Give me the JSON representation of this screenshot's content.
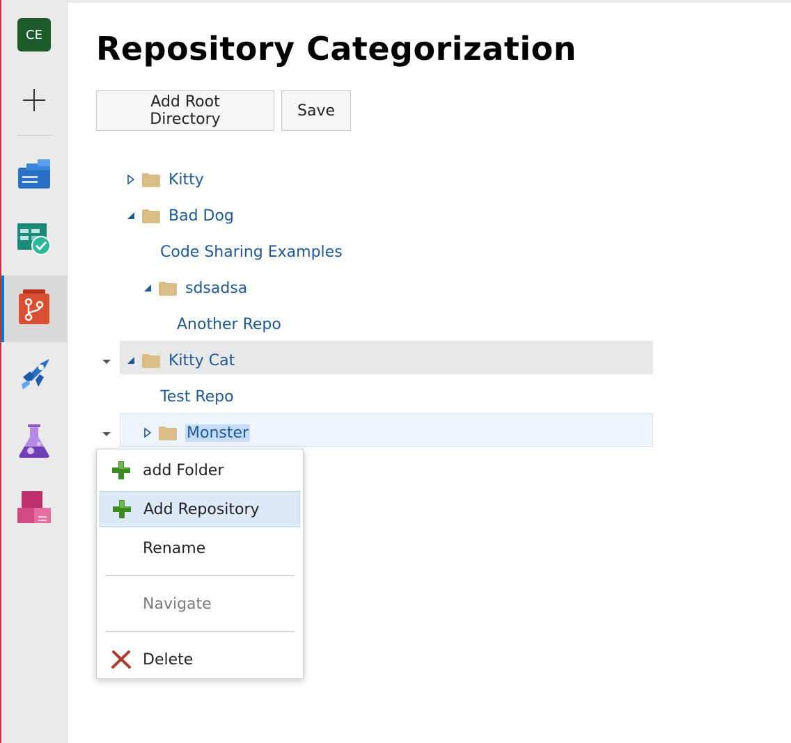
{
  "sidebar": {
    "avatar_initials": "CE",
    "items": [
      {
        "name": "new-icon"
      },
      {
        "name": "boards-icon"
      },
      {
        "name": "test-plans-check-icon"
      },
      {
        "name": "repos-icon",
        "active": true
      },
      {
        "name": "pipelines-icon"
      },
      {
        "name": "test-flask-icon"
      },
      {
        "name": "artifacts-icon"
      }
    ]
  },
  "page": {
    "title": "Repository Categorization",
    "buttons": {
      "add_root": "Add Root Directory",
      "save": "Save"
    }
  },
  "tree": {
    "nodes": [
      {
        "label": "Kitty",
        "type": "folder",
        "expanded": false
      },
      {
        "label": "Bad Dog",
        "type": "folder",
        "expanded": true
      },
      {
        "label": "Code Sharing Examples",
        "type": "repo"
      },
      {
        "label": "sdsadsa",
        "type": "folder",
        "expanded": true
      },
      {
        "label": "Another Repo",
        "type": "repo"
      },
      {
        "label": "Kitty Cat",
        "type": "folder",
        "expanded": true,
        "hovered": true
      },
      {
        "label": "Test Repo",
        "type": "repo"
      },
      {
        "label": "Monster",
        "type": "folder",
        "expanded": false,
        "selected": true
      }
    ]
  },
  "context_menu": {
    "items": [
      {
        "label": "add Folder",
        "icon": "plus-icon"
      },
      {
        "label": "Add Repository",
        "icon": "plus-icon",
        "highlighted": true
      },
      {
        "label": "Rename"
      },
      {
        "label": "Navigate",
        "disabled": true
      },
      {
        "label": "Delete",
        "icon": "delete-x-icon"
      }
    ]
  },
  "colors": {
    "link": "#1f5897",
    "folder": "#d9bd86",
    "plus": "#3b8a22",
    "delete": "#b03a2e",
    "avatar_bg": "#1e5b2a"
  }
}
